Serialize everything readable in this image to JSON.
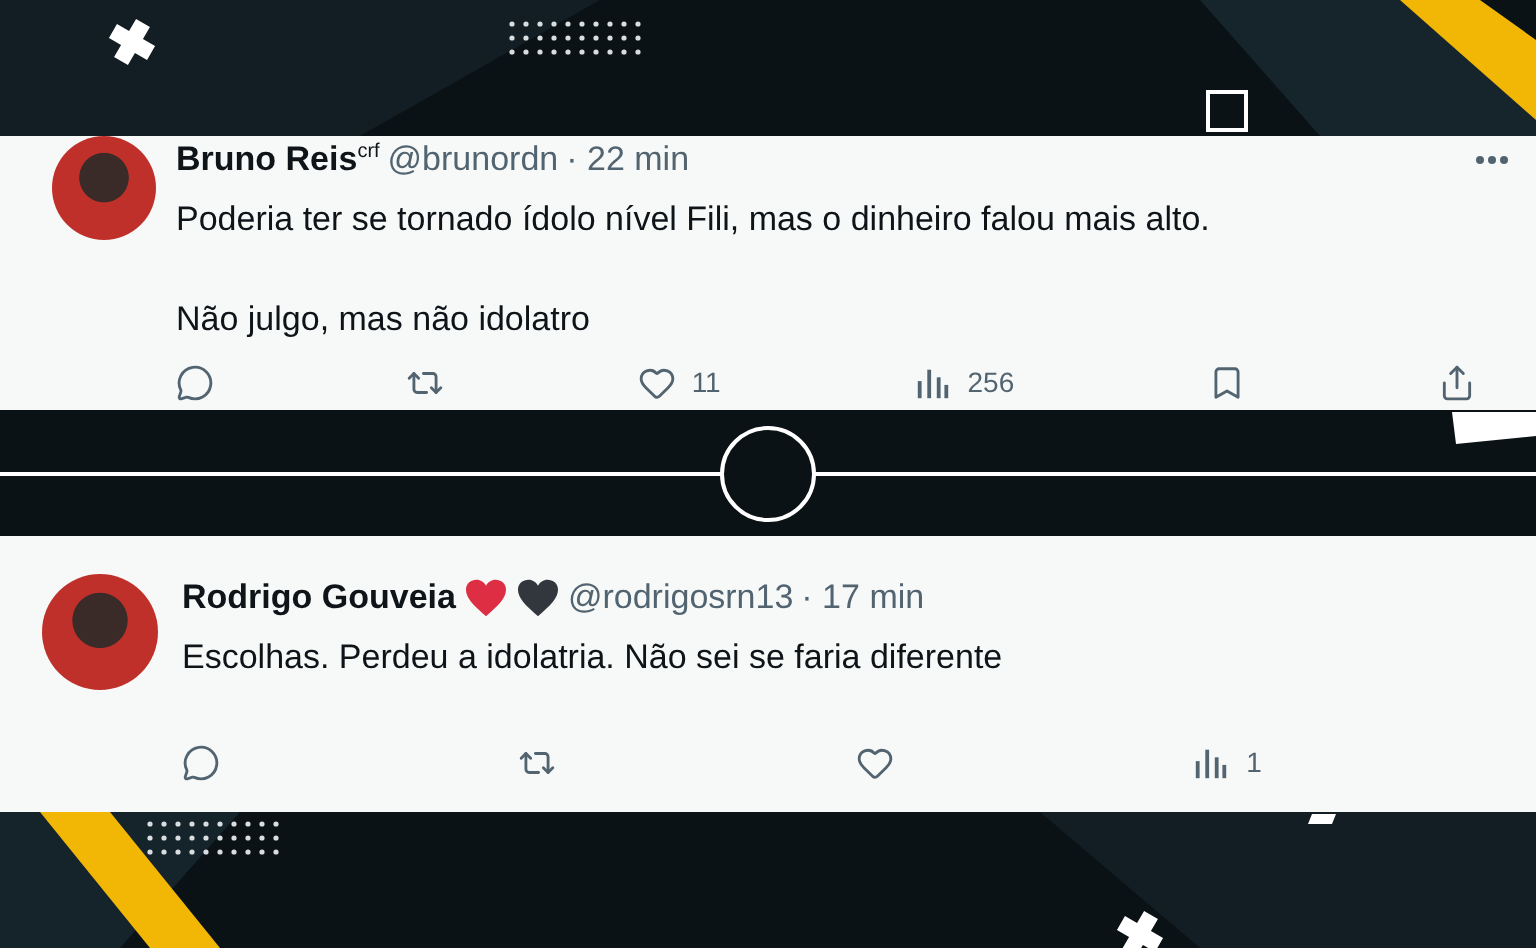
{
  "tweets": [
    {
      "name": "Bruno Reis$^{crf}$",
      "handle": "@brunordn",
      "time": "· 22 min",
      "more_menu": true,
      "paragraphs": [
        "Poderia ter se tornado ídolo nível Fili, mas o dinheiro falou mais alto.",
        "Não julgo, mas não idolatro"
      ],
      "actions": [
        {
          "kind": "reply"
        },
        {
          "kind": "retweet"
        },
        {
          "kind": "like",
          "count": "11"
        },
        {
          "kind": "views",
          "count": "256"
        },
        {
          "kind": "bookmark"
        },
        {
          "kind": "share"
        }
      ]
    },
    {
      "name": "Rodrigo Gouveia",
      "badges": [
        {
          "kind": "heart",
          "color": "#dd2e44"
        },
        {
          "kind": "heart",
          "color": "#31373d"
        }
      ],
      "handle": "@rodrigosrn13",
      "time": "· 17 min",
      "more_menu": false,
      "paragraphs": [
        "Escolhas. Perdeu a idolatria. Não sei se faria diferente"
      ],
      "actions": [
        {
          "kind": "reply"
        },
        {
          "kind": "retweet"
        },
        {
          "kind": "like"
        },
        {
          "kind": "views",
          "count": "1"
        }
      ]
    }
  ]
}
